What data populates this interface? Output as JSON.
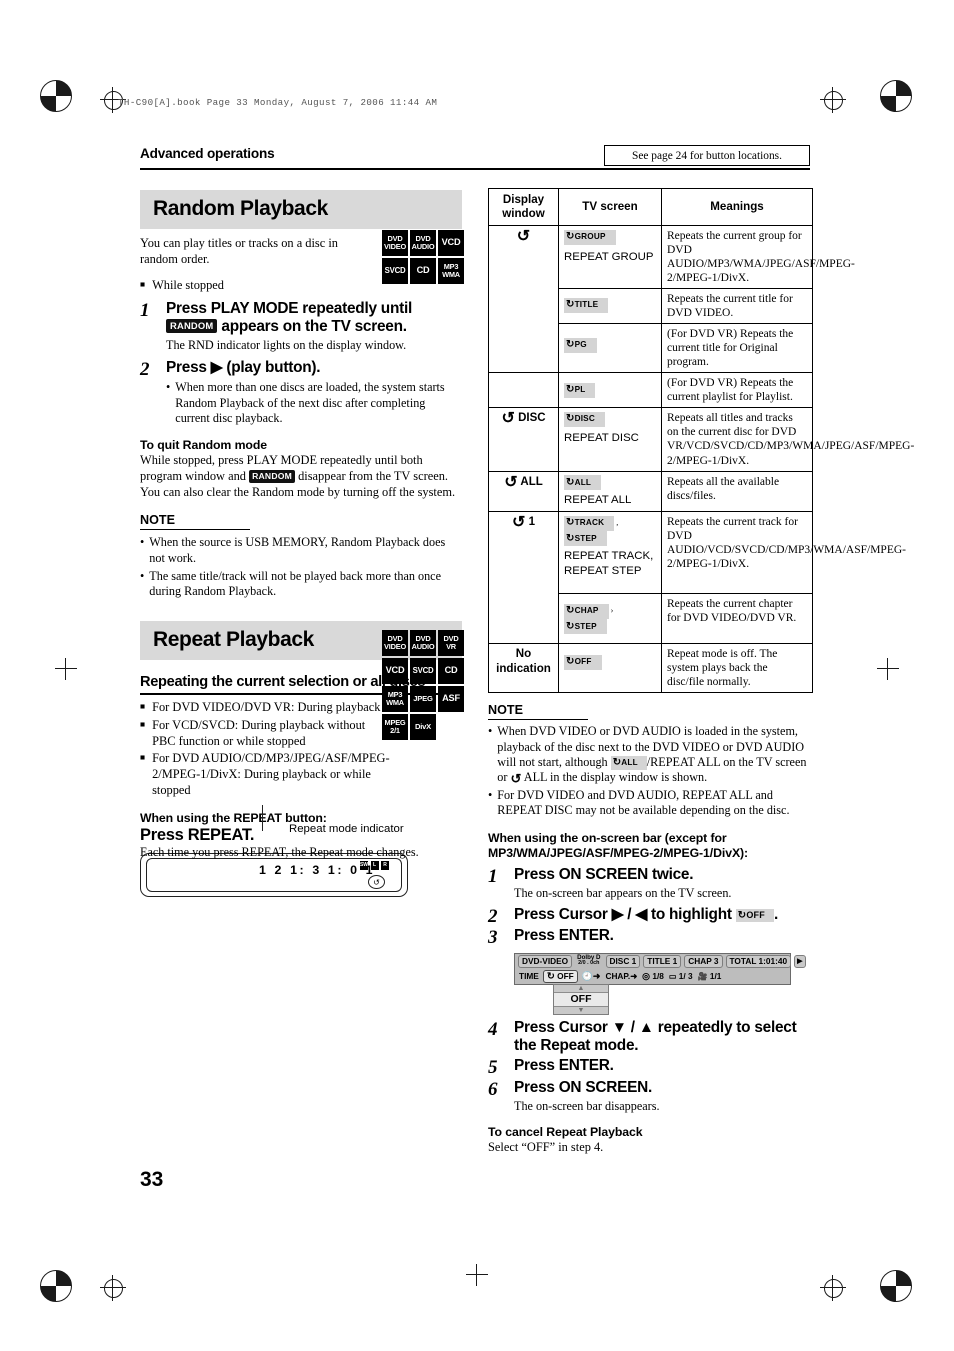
{
  "header": {
    "filestamp": "TH-C90[A].book   Page 33   Monday, August 7, 2006   11:44 AM",
    "running_head": "Advanced operations",
    "see_page_note": "See page 24 for button locations."
  },
  "page_number": "33",
  "random_playback": {
    "title": "Random Playback",
    "intro": "You can play titles or tracks on a disc in random order.",
    "condition": "While stopped",
    "badges": [
      "DVD VIDEO",
      "DVD AUDIO",
      "VCD",
      "SVCD",
      "CD",
      "MP3 WMA"
    ],
    "steps": [
      {
        "num": "1",
        "heading_before": "Press PLAY MODE repeatedly until",
        "chip": "RANDOM",
        "heading_after": "appears on the TV screen.",
        "sub": "The RND indicator lights on the display window."
      },
      {
        "num": "2",
        "heading": "Press ▶ (play button).",
        "bullet": "When more than one discs are loaded, the system starts Random Playback of the next disc after completing current disc playback."
      }
    ],
    "quit": {
      "heading": "To quit Random mode",
      "line1a": "While stopped, press PLAY MODE repeatedly until both program window and",
      "chip": "RANDOM",
      "line1b": "disappear from the TV screen.",
      "line2": "You can also clear the Random mode by turning off the system."
    },
    "note": {
      "heading": "NOTE",
      "items": [
        "When the source is USB MEMORY, Random Playback does not work.",
        "The same title/track will not be played back more than once during Random Playback."
      ]
    }
  },
  "repeat_playback": {
    "title": "Repeat Playback",
    "subhead": "Repeating the current selection or all discs",
    "conditions": [
      "For DVD VIDEO/DVD VR: During playback",
      "For VCD/SVCD: During playback without PBC function or while stopped",
      "For DVD AUDIO/CD/MP3/JPEG/ASF/MPEG-2/MPEG-1/DivX: During playback or while stopped"
    ],
    "badges": [
      "DVD VIDEO",
      "DVD AUDIO",
      "DVD VR",
      "VCD",
      "SVCD",
      "CD",
      "MP3 WMA",
      "JPEG",
      "ASF",
      "MPEG 2/1",
      "DivX",
      ""
    ],
    "button_intro": "When using the REPEAT button:",
    "button_action": "Press REPEAT.",
    "display_window": {
      "digits": "1 2     1: 3 1: 0 1",
      "small_icons": [
        "SW",
        "L",
        "R"
      ],
      "repeat_glyph": "↺",
      "callout": "Repeat mode indicator"
    },
    "each_time": "Each time you press REPEAT, the Repeat mode changes."
  },
  "table": {
    "headers": [
      "Display window",
      "TV screen",
      "Meanings"
    ],
    "rows": [
      {
        "display": "",
        "display_span": 4,
        "display_glyph": "↺",
        "tv_chip": "GROUP",
        "tv_text": "REPEAT GROUP",
        "meaning": "Repeats the current group for DVD AUDIO/MP3/WMA/JPEG/ASF/MPEG-2/MPEG-1/DivX."
      },
      {
        "tv_chip": "TITLE",
        "tv_text": "",
        "meaning": "Repeats the current title for DVD VIDEO."
      },
      {
        "tv_chip": "PG",
        "tv_text": "",
        "meaning": "(For DVD VR) Repeats the current title for Original program."
      },
      {
        "tv_chip": "PL",
        "tv_text": "",
        "meaning": "(For DVD VR) Repeats the current playlist for Playlist."
      },
      {
        "display_glyph": "↺",
        "display": "DISC",
        "tv_chip": "DISC",
        "tv_text": "REPEAT DISC",
        "meaning": "Repeats all titles and tracks on the current disc for DVD VR/VCD/SVCD/CD/MP3/WMA/JPEG/ASF/MPEG-2/MPEG-1/DivX."
      },
      {
        "display_glyph": "↺",
        "display": "ALL",
        "tv_chip": "ALL",
        "tv_text": "REPEAT ALL",
        "meaning": "Repeats all the available discs/files."
      },
      {
        "display_glyph": "↺",
        "display": "1",
        "display_span": 2,
        "tv_chip": "TRACK",
        "tv_chip2": "STEP",
        "tv_text": "REPEAT TRACK, REPEAT STEP",
        "meaning": "Repeats the current track for DVD AUDIO/VCD/SVCD/CD/MP3/WMA/ASF/MPEG-2/MPEG-1/DivX."
      },
      {
        "tv_chip": "CHAP",
        "tv_chip2": "STEP",
        "tv_text": "",
        "meaning": "Repeats the current chapter for DVD VIDEO/DVD VR."
      },
      {
        "display": "No indication",
        "tv_chip": "OFF",
        "tv_text": "",
        "meaning": "Repeat mode is off. The system plays back the disc/file normally."
      }
    ]
  },
  "table_note": {
    "heading": "NOTE",
    "item1a": "When DVD VIDEO or DVD AUDIO is loaded in the system, playback of the disc next to the DVD VIDEO or DVD AUDIO will not start, although",
    "item1_chip": "ALL",
    "item1b": "/REPEAT ALL on the TV screen or",
    "item1_glyph": "↺",
    "item1c": "ALL in the display window is shown.",
    "item2": "For DVD VIDEO and DVD AUDIO, REPEAT ALL and REPEAT DISC may not be available depending on the disc."
  },
  "onscreen": {
    "intro": "When using the on-screen bar (except for MP3/WMA/JPEG/ASF/MPEG-2/MPEG-1/DivX):",
    "steps": [
      {
        "num": "1",
        "heading": "Press ON SCREEN twice.",
        "sub": "The on-screen bar appears on the TV screen."
      },
      {
        "num": "2",
        "heading_before": "Press Cursor ▶ / ◀ to highlight",
        "chip": "OFF",
        "heading_after": "."
      },
      {
        "num": "3",
        "heading": "Press ENTER."
      },
      {
        "num": "4",
        "heading": "Press Cursor ▼ / ▲ repeatedly to select the Repeat mode."
      },
      {
        "num": "5",
        "heading": "Press ENTER."
      },
      {
        "num": "6",
        "heading": "Press ON SCREEN.",
        "sub": "The on-screen bar disappears."
      }
    ],
    "bar": {
      "row1": [
        "DVD-VIDEO",
        "Dolby D 2/0 . 0ch",
        "DISC 1",
        "TITLE 1",
        "CHAP 3",
        "TOTAL  1:01:40"
      ],
      "row1_next": "▶",
      "row2_time": "TIME",
      "row2_repeat_chip": "OFF",
      "row2_items": [
        "CHAP.",
        "1/8",
        "1/ 3",
        "1/1"
      ],
      "dropdown_value": "OFF"
    },
    "cancel": {
      "heading": "To cancel Repeat Playback",
      "text": "Select “OFF” in step 4."
    }
  }
}
